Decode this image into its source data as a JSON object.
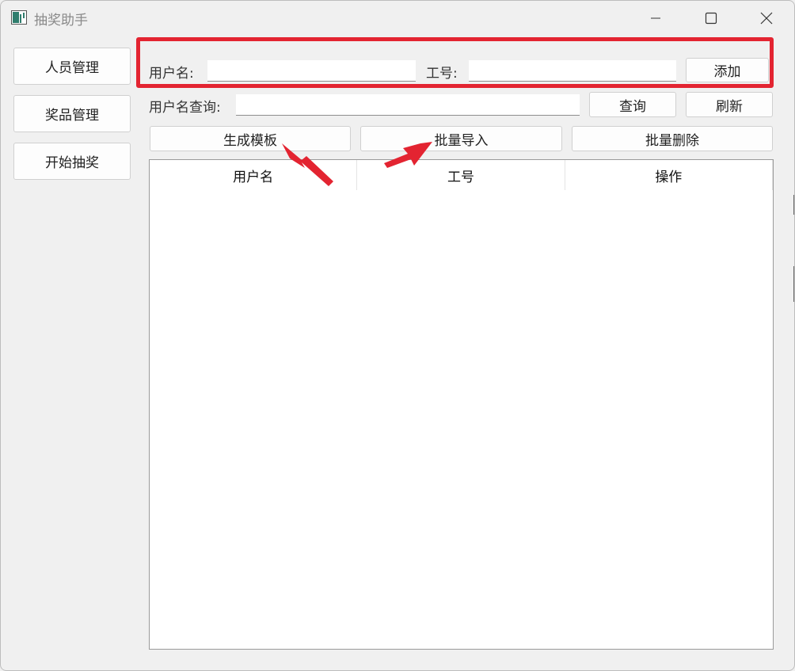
{
  "window": {
    "title": "抽奖助手"
  },
  "sidebar": {
    "items": [
      {
        "label": "人员管理"
      },
      {
        "label": "奖品管理"
      },
      {
        "label": "开始抽奖"
      }
    ]
  },
  "add_form": {
    "username_label": "用户名:",
    "username_value": "",
    "employee_id_label": "工号:",
    "employee_id_value": "",
    "add_button": "添加"
  },
  "query_form": {
    "query_label": "用户名查询:",
    "query_value": "",
    "query_button": "查询",
    "refresh_button": "刷新"
  },
  "actions": {
    "generate_template": "生成模板",
    "batch_import": "批量导入",
    "batch_delete": "批量删除"
  },
  "table": {
    "columns": [
      "用户名",
      "工号",
      "操作"
    ],
    "rows": []
  },
  "annotations": {
    "highlight_color": "#e32431",
    "arrow_color": "#e32431"
  }
}
